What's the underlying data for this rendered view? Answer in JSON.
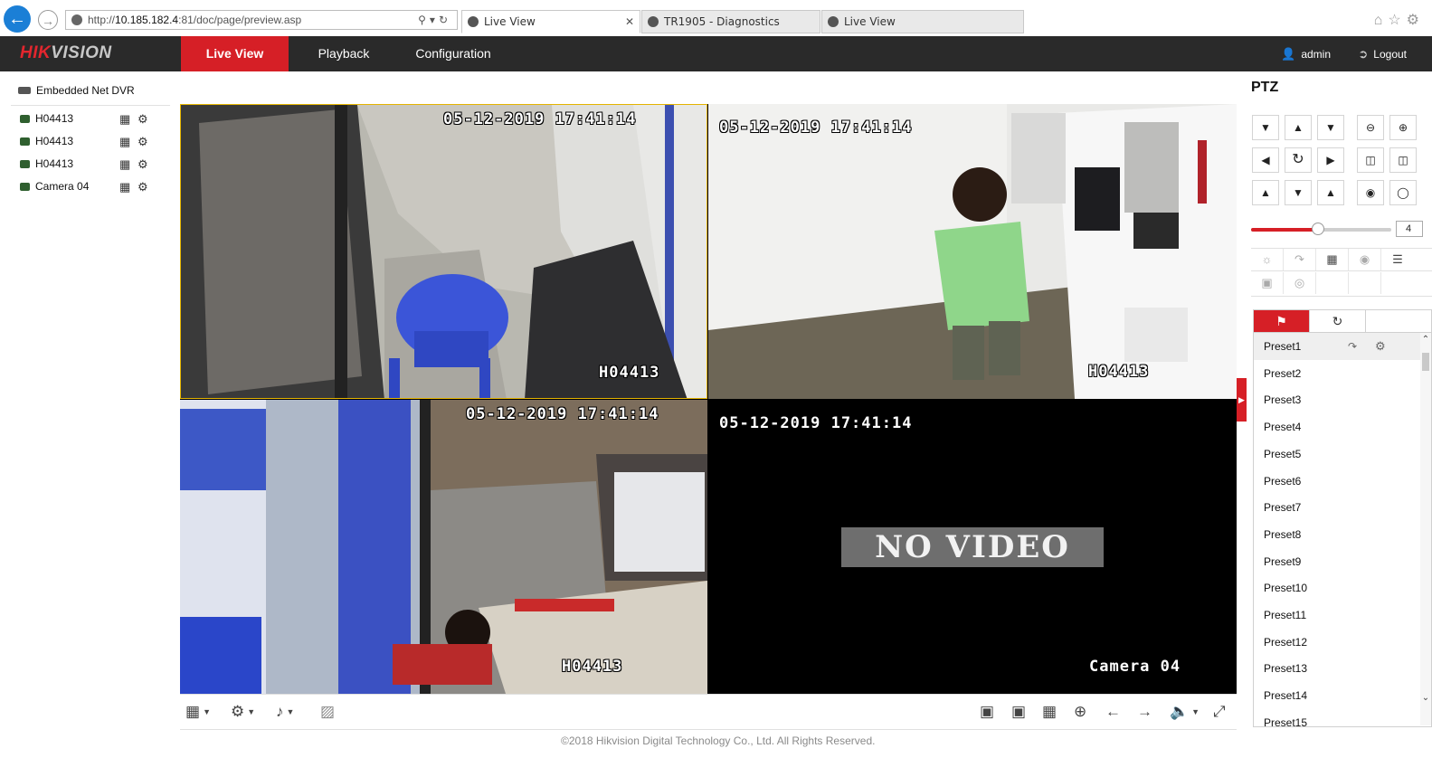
{
  "browser": {
    "address_scheme": "http://",
    "address_host": "10.185.182.4",
    "address_rest": ":81/doc/page/preview.asp",
    "tabs": [
      {
        "title": "Live View",
        "active": true
      },
      {
        "title": "TR1905 - Diagnostics",
        "active": false
      },
      {
        "title": "Live View",
        "active": false
      }
    ]
  },
  "header": {
    "logo_red": "HIK",
    "logo_grey": "VISION",
    "tabs": [
      "Live View",
      "Playback",
      "Configuration"
    ],
    "user": "admin",
    "logout": "Logout"
  },
  "device_tree": {
    "root": "Embedded Net DVR",
    "cameras": [
      "H04413",
      "H04413",
      "H04413",
      "Camera 04"
    ]
  },
  "video": {
    "tiles": [
      {
        "timestamp": "05-12-2019 17:41:14",
        "camera_label": "H04413",
        "selected": true
      },
      {
        "timestamp": "05-12-2019 17:41:14",
        "camera_label": "H04413",
        "selected": false
      },
      {
        "timestamp": "05-12-2019 17:41:14",
        "camera_label": "H04413",
        "selected": false
      },
      {
        "timestamp": "05-12-2019 17:41:14",
        "camera_label": "Camera 04",
        "no_video": "NO VIDEO"
      }
    ]
  },
  "ptz": {
    "title": "PTZ",
    "speed": "4",
    "speed_level": 0.48,
    "presets": [
      "Preset1",
      "Preset2",
      "Preset3",
      "Preset4",
      "Preset5",
      "Preset6",
      "Preset7",
      "Preset8",
      "Preset9",
      "Preset10",
      "Preset11",
      "Preset12",
      "Preset13",
      "Preset14",
      "Preset15"
    ]
  },
  "footer": "©2018 Hikvision Digital Technology Co., Ltd. All Rights Reserved.",
  "colors": {
    "brand_red": "#d61f26",
    "header_bg": "#2a2a2a",
    "selected_border": "#e4b400"
  }
}
